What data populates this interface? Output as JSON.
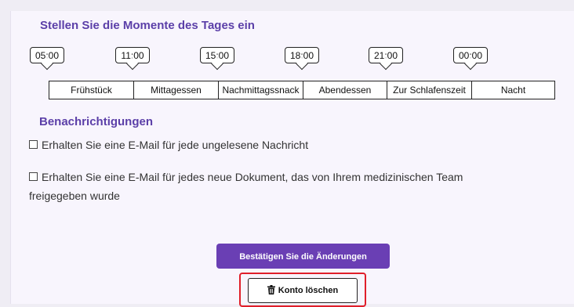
{
  "moments": {
    "title": "Stellen Sie die Momente des Tages ein",
    "times": [
      "05:00",
      "11:00",
      "15:00",
      "18:00",
      "21:00",
      "00:00"
    ],
    "meals": [
      "Frühstück",
      "Mittagessen",
      "Nachmittagssnack",
      "Abendessen",
      "Zur Schlafenszeit",
      "Nacht"
    ]
  },
  "notifications": {
    "title": "Benachrichtigungen",
    "option_unread": "Erhalten Sie eine E-Mail für jede ungelesene Nachricht",
    "option_document_line1": "Erhalten Sie eine E-Mail für jedes neue Dokument, das von Ihrem medizinischen Team",
    "option_document_line2": "freigegeben wurde"
  },
  "actions": {
    "confirm_label": "Bestätigen Sie die Änderungen",
    "delete_label": "Konto löschen"
  }
}
